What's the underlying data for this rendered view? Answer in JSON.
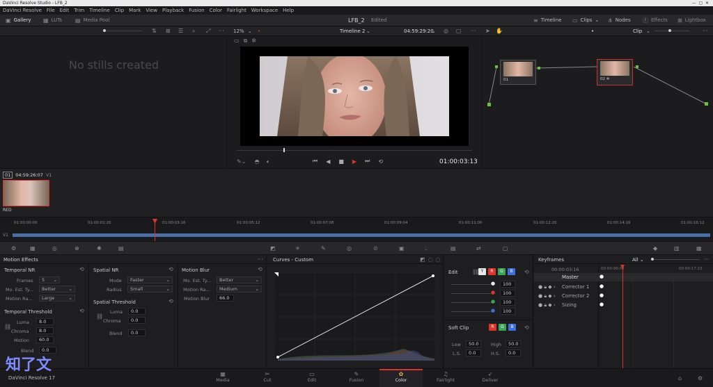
{
  "window": {
    "title": "DaVinci Resolve Studio - LFB_2"
  },
  "menu": [
    "DaVinci Resolve",
    "File",
    "Edit",
    "Trim",
    "Timeline",
    "Clip",
    "Mark",
    "View",
    "Playback",
    "Fusion",
    "Color",
    "Fairlight",
    "Workspace",
    "Help"
  ],
  "toolbar": {
    "gallery": "Gallery",
    "luts": "LUTs",
    "media_pool": "Media Pool",
    "project": "LFB_2",
    "edited": "Edited",
    "timeline": "Timeline",
    "clips": "Clips",
    "nodes": "Nodes",
    "effects": "Effects",
    "lightbox": "Lightbox"
  },
  "subbar": {
    "zoom": "12%",
    "timeline_name": "Timeline 2",
    "timecode": "04:59:29:20",
    "clip_mode": "Clip"
  },
  "gallery": {
    "empty": "No stills created"
  },
  "viewer": {
    "timecode": "01:00:03:13"
  },
  "nodes": [
    {
      "label": "01"
    },
    {
      "label": "02"
    }
  ],
  "clip": {
    "index": "01",
    "timecode": "04:59:26:07",
    "track": "V1",
    "codec": "RED"
  },
  "timeline": {
    "ticks": [
      "01:00:00:00",
      "01:00:01:20",
      "01:00:03:16",
      "01:00:05:12",
      "01:00:07:08",
      "01:00:09:04",
      "01:00:11:00",
      "01:00:12:20",
      "01:00:14:16",
      "01:00:16:12"
    ],
    "track": "V1"
  },
  "motion_effects": {
    "title": "Motion Effects",
    "temporal_nr": {
      "title": "Temporal NR",
      "frames_label": "Frames",
      "frames": "5",
      "mo_est_label": "Mo. Est. Ty...",
      "mo_est": "Better",
      "motion_range_label": "Motion Ra...",
      "motion_range": "Large"
    },
    "temporal_threshold": {
      "title": "Temporal Threshold",
      "luma_label": "Luma",
      "luma": "8.0",
      "chroma_label": "Chroma",
      "chroma": "8.0",
      "motion_label": "Motion",
      "motion": "60.0",
      "blend_label": "Blend",
      "blend": "0.0"
    },
    "spatial_nr": {
      "title": "Spatial NR",
      "mode_label": "Mode",
      "mode": "Faster",
      "radius_label": "Radius",
      "radius": "Small"
    },
    "spatial_threshold": {
      "title": "Spatial Threshold",
      "luma_label": "Luma",
      "luma": "0.0",
      "chroma_label": "Chroma",
      "chroma": "0.0",
      "blend_label": "Blend",
      "blend": "0.0"
    },
    "motion_blur": {
      "title": "Motion Blur",
      "mo_est_label": "Mo. Est. Ty...",
      "mo_est": "Better",
      "motion_range_label": "Motion Ra...",
      "motion_range": "Medium",
      "blur_label": "Motion Blur",
      "blur": "66.0"
    }
  },
  "curves": {
    "title": "Curves - Custom"
  },
  "edit": {
    "title": "Edit",
    "channels": [
      "Y",
      "R",
      "G",
      "B"
    ],
    "values": [
      "100",
      "100",
      "100",
      "100"
    ],
    "channel_colors": [
      "#e8e8e8",
      "#e0342b",
      "#3aa655",
      "#3d6fe0"
    ],
    "soft_clip": {
      "title": "Soft Clip",
      "low_label": "Low",
      "low": "50.0",
      "high_label": "High",
      "high": "50.0",
      "ls_label": "L.S.",
      "ls": "0.0",
      "hs_label": "H.S.",
      "hs": "0.0"
    }
  },
  "keyframes": {
    "title": "Keyframes",
    "filter": "All",
    "timecode": "00:00:03:16",
    "start": "00:00:00:00",
    "end": "00:00:17:23",
    "tracks": [
      "Master",
      "Corrector 1",
      "Corrector 2",
      "Sizing"
    ]
  },
  "pages": [
    "Media",
    "Cut",
    "Edit",
    "Fusion",
    "Color",
    "Fairlight",
    "Deliver"
  ],
  "active_page": "Color",
  "brand": {
    "name": "DaVinci Resolve 17",
    "watermark": "知了文"
  }
}
